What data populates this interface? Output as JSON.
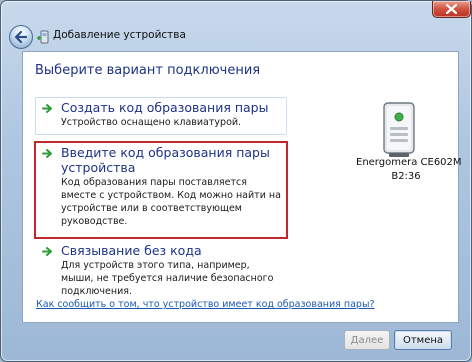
{
  "window": {
    "title": "Добавление устройства"
  },
  "heading": "Выберите вариант подключения",
  "options": [
    {
      "title": "Создать код образования пары",
      "description": "Устройство оснащено клавиатурой."
    },
    {
      "title": "Введите код образования пары устройства",
      "description": "Код образования пары поставляется вместе с устройством. Код можно найти на устройстве или в соответствующем руководстве."
    },
    {
      "title": "Связывание без кода",
      "description": "Для устройств этого типа, например, мыши, не требуется наличие безопасного подключения."
    }
  ],
  "device": {
    "name": "Energomera CE602M",
    "address": "B2:36",
    "icon": "device-meter-icon"
  },
  "help_link": "Как сообщить о том, что устройство имеет код образования пары?",
  "buttons": {
    "next": "Далее",
    "cancel": "Отмена"
  },
  "colors": {
    "heading": "#1e3287",
    "selection_border": "#c4262e",
    "arrow": "#2e9c3a",
    "link": "#1a58b4"
  }
}
